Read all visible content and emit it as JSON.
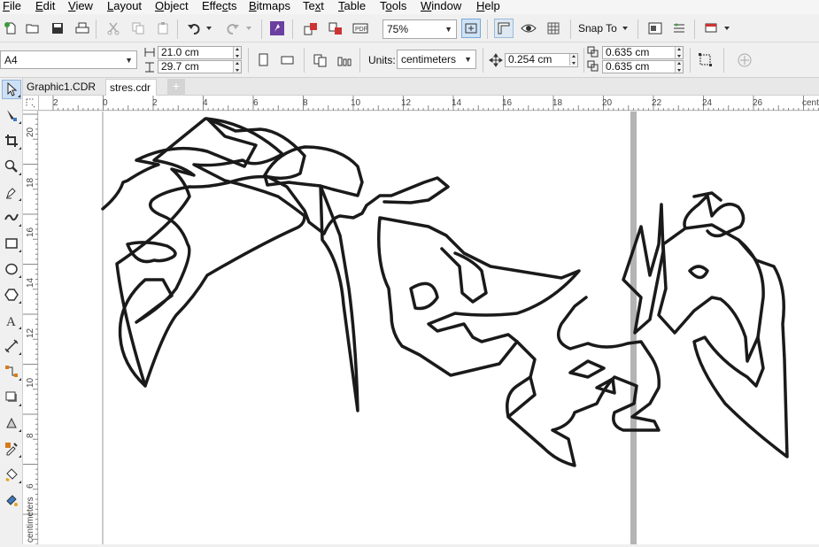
{
  "menu": [
    {
      "label": "File",
      "u": "F"
    },
    {
      "label": "Edit",
      "u": "E"
    },
    {
      "label": "View",
      "u": "V"
    },
    {
      "label": "Layout",
      "u": "L"
    },
    {
      "label": "Object",
      "u": "O"
    },
    {
      "label": "Effects",
      "u": "c"
    },
    {
      "label": "Bitmaps",
      "u": "B"
    },
    {
      "label": "Text",
      "u": "x"
    },
    {
      "label": "Table",
      "u": "T"
    },
    {
      "label": "Tools",
      "u": "o"
    },
    {
      "label": "Window",
      "u": "W"
    },
    {
      "label": "Help",
      "u": "H"
    }
  ],
  "standard_toolbar": {
    "zoom_value": "75%",
    "snap_to_label": "Snap To"
  },
  "property_bar": {
    "page_size": "A4",
    "width": "21.0 cm",
    "height": "29.7 cm",
    "units_label": "Units:",
    "units_value": "centimeters",
    "nudge": "0.254 cm",
    "dup_x": "0.635 cm",
    "dup_y": "0.635 cm"
  },
  "document_tabs": [
    {
      "label": "Graphic1.CDR",
      "active": false
    },
    {
      "label": "stres.cdr",
      "active": true
    }
  ],
  "ruler": {
    "h_ticks": [
      "2",
      "0",
      "2",
      "4",
      "6",
      "8",
      "10",
      "12",
      "14",
      "16",
      "18",
      "20",
      "22",
      "24",
      "26",
      "centimeters"
    ],
    "v_ticks": [
      "20",
      "18",
      "16",
      "14",
      "12",
      "10",
      "8",
      "6"
    ],
    "v_unit": "centimeters"
  },
  "colors": {
    "accent_purple": "#6a3fa0",
    "page_shadow": "#b4b4b4",
    "artwork_stroke": "#1a1a1a"
  }
}
